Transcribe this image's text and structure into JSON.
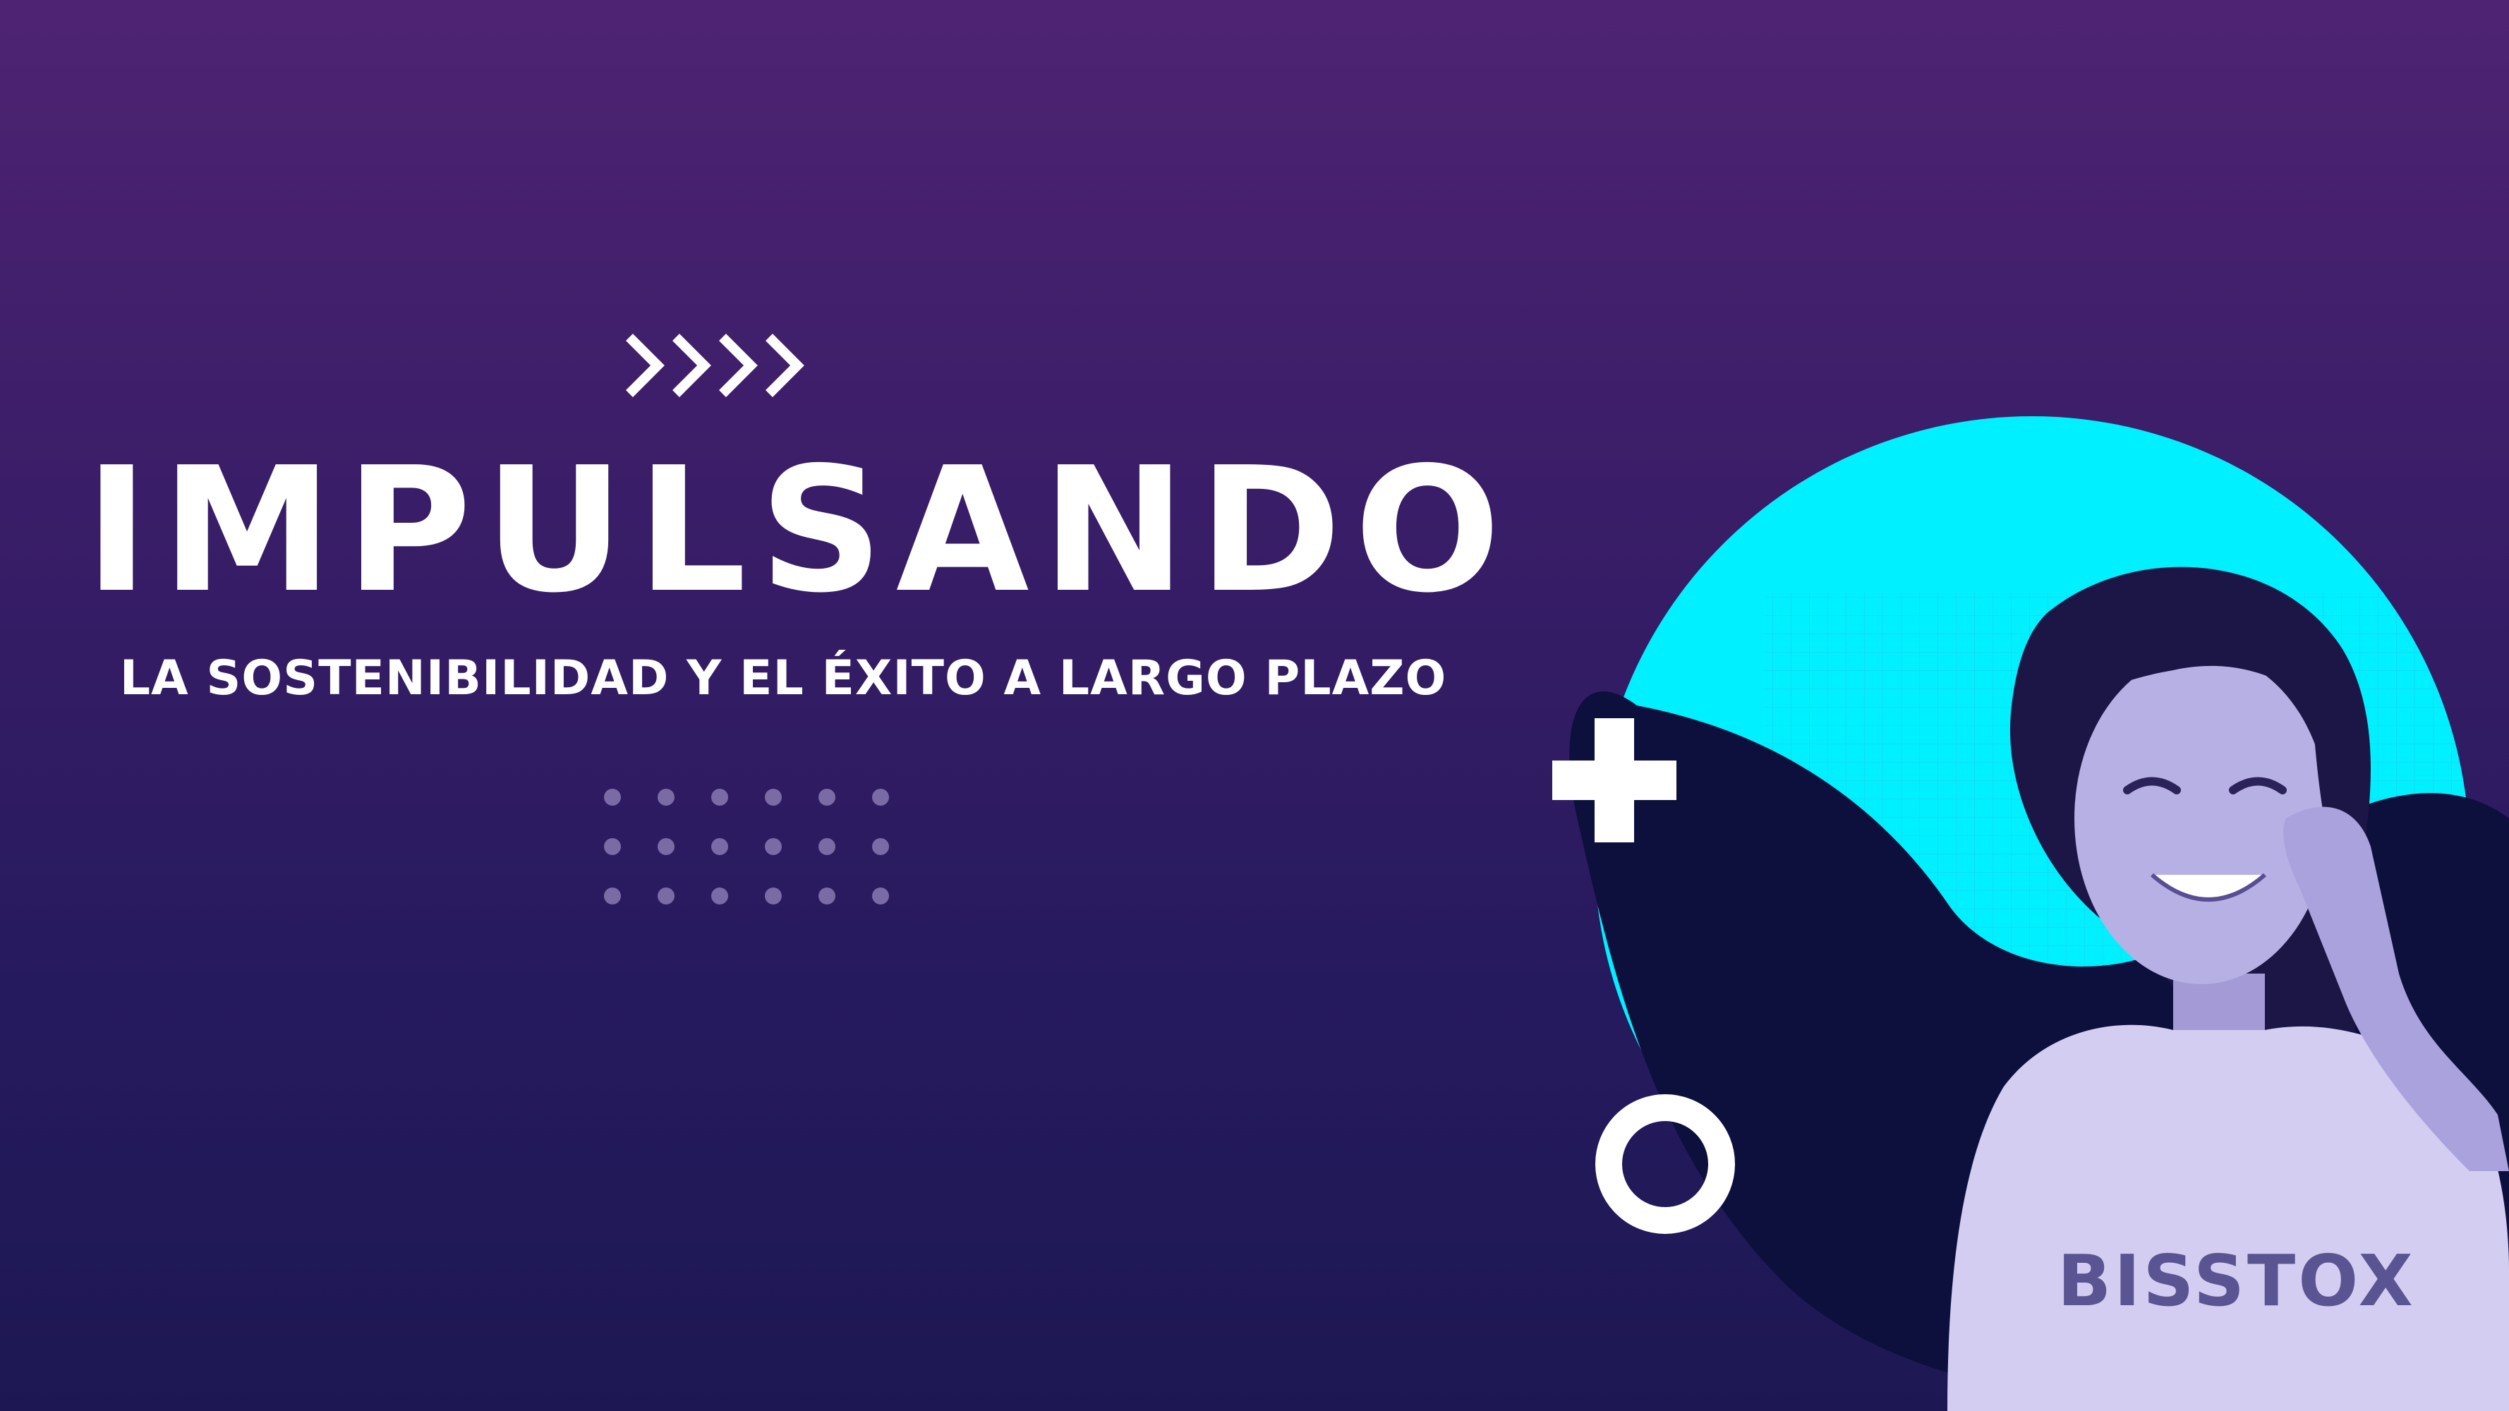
{
  "headline": "IMPULSANDO",
  "subheadline": "LA SOSTENIBILIDAD Y EL ÉXITO A LARGO PLAZO",
  "shirt_logo": "BISSTOX",
  "colors": {
    "bg_top": "#4e2373",
    "bg_bottom": "#1d1853",
    "cyan": "#00f0ff",
    "navy_blob": "#0d0f3d",
    "white": "#ffffff"
  },
  "icons": {
    "decorative_arrows": "chevron-right-icon",
    "decorative_plus": "plus-icon",
    "decorative_ring": "ring-icon"
  }
}
